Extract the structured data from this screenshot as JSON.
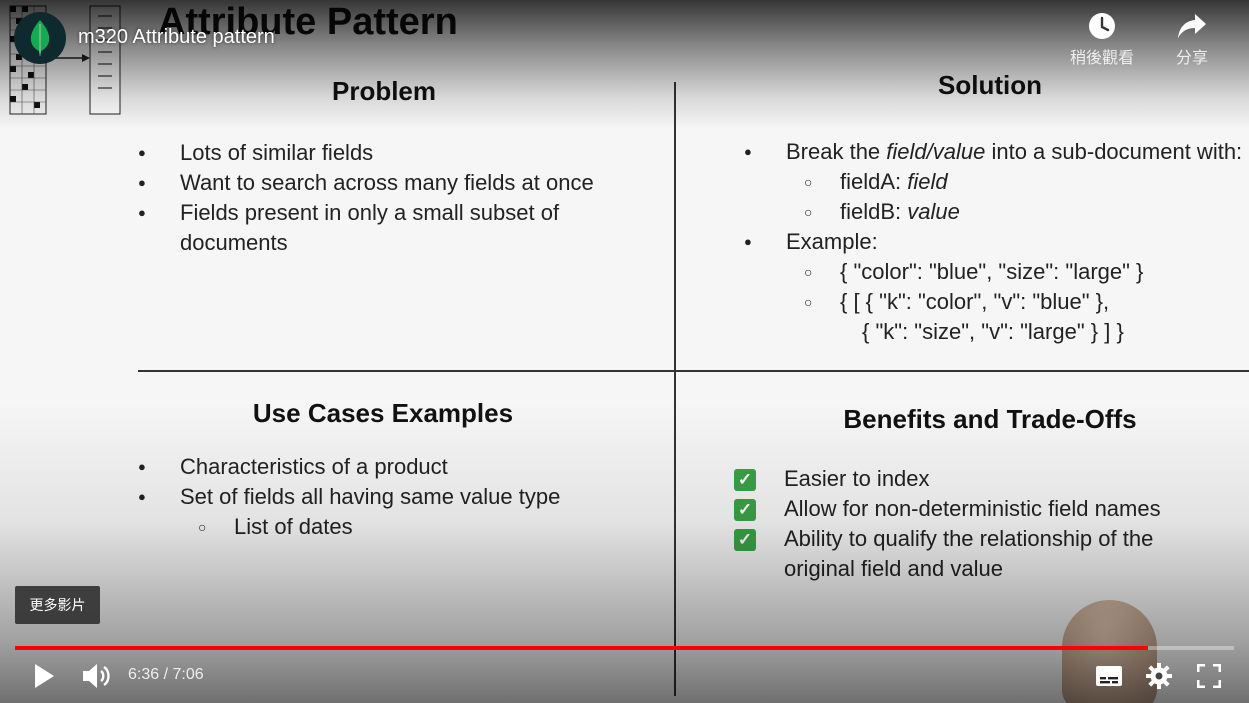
{
  "slide": {
    "title": "Attribute Pattern",
    "problem": {
      "heading": "Problem",
      "items": [
        "Lots of similar fields",
        "Want to search across many fields at once",
        "Fields present in only a small subset of documents"
      ]
    },
    "solution": {
      "heading": "Solution",
      "item1": "Break the field/value into a sub-document with:",
      "item1_pre": "Break the ",
      "item1_em": "field/value",
      "item1_post": " into a sub-document with:",
      "sub1_label": "fieldA: ",
      "sub1_value": "field",
      "sub2_label": "fieldB: ",
      "sub2_value": "value",
      "item2": "Example:",
      "example1": "{ \"color\": \"blue\", \"size\": \"large\" }",
      "example2_line1": "{ [ { \"k\": \"color\", \"v\": \"blue\" },",
      "example2_line2": "{ \"k\": \"size\", \"v\": \"large\" } ] }"
    },
    "use_cases": {
      "heading": "Use Cases Examples",
      "items": [
        "Characteristics of a product",
        "Set of fields all having same value type"
      ],
      "sub_item": "List of dates"
    },
    "benefits": {
      "heading": "Benefits and Trade-Offs",
      "items": [
        "Easier to index",
        "Allow for non-deterministic field names",
        "Ability to qualify the relationship of the original field and value"
      ]
    }
  },
  "player": {
    "video_title": "m320 Attribute pattern",
    "watch_later_label": "稍後觀看",
    "share_label": "分享",
    "more_videos_label": "更多影片",
    "time_display": "6:36 / 7:06",
    "progress_fraction": 0.9296,
    "accent_color": "#ff0000"
  },
  "icons": {
    "channel": "mongodb-leaf-icon",
    "watch_later": "clock-icon",
    "share": "share-arrow-icon",
    "play": "play-icon",
    "volume": "volume-icon",
    "subtitles": "subtitles-icon",
    "settings": "gear-icon",
    "fullscreen": "fullscreen-icon"
  }
}
